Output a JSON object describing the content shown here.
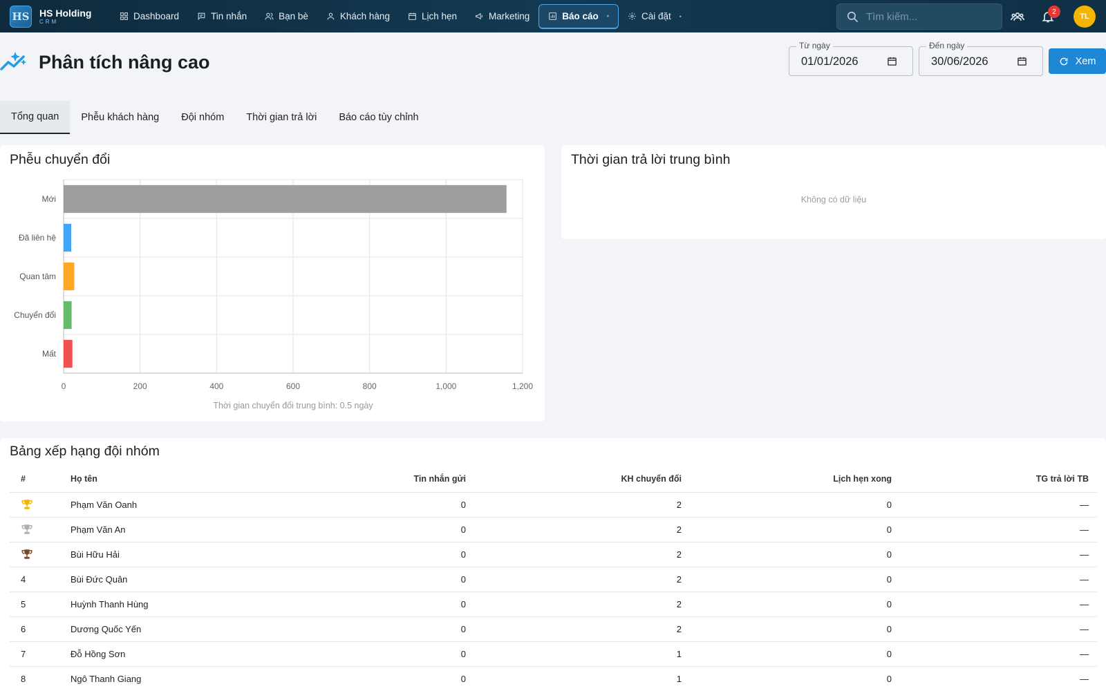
{
  "brand": {
    "name": "HS Holding",
    "sub": "CRM",
    "logo": "HS"
  },
  "nav": [
    {
      "label": "Dashboard",
      "icon": "dashboard-icon"
    },
    {
      "label": "Tin nhắn",
      "icon": "chat-icon"
    },
    {
      "label": "Bạn bè",
      "icon": "friends-icon"
    },
    {
      "label": "Khách hàng",
      "icon": "person-icon"
    },
    {
      "label": "Lịch hẹn",
      "icon": "calendar-icon"
    },
    {
      "label": "Marketing",
      "icon": "megaphone-icon"
    },
    {
      "label": "Báo cáo",
      "icon": "chart-icon",
      "active": true
    },
    {
      "label": "Cài đặt",
      "icon": "gear-icon"
    }
  ],
  "search": {
    "placeholder": "Tìm kiếm..."
  },
  "notifications": {
    "count": "2"
  },
  "user": {
    "initials": "TL"
  },
  "page": {
    "title": "Phân tích nâng cao"
  },
  "filters": {
    "from_label": "Từ ngày",
    "from_value": "01/01/2026",
    "to_label": "Đến ngày",
    "to_value": "30/06/2026",
    "view_label": "Xem"
  },
  "tabs": [
    "Tổng quan",
    "Phễu khách hàng",
    "Đội nhóm",
    "Thời gian trả lời",
    "Báo cáo tùy chỉnh"
  ],
  "funnel_card": {
    "title": "Phễu chuyển đổi",
    "note": "Thời gian chuyển đổi trung bình: 0.5 ngày"
  },
  "response_card": {
    "title": "Thời gian trả lời trung bình",
    "empty": "Không có dữ liệu"
  },
  "chart_data": {
    "type": "bar",
    "orientation": "horizontal",
    "categories": [
      "Mới",
      "Đã liên hệ",
      "Quan tâm",
      "Chuyển đổi",
      "Mất"
    ],
    "values": [
      1158,
      20,
      28,
      21,
      23
    ],
    "colors": [
      "#9e9e9e",
      "#42a5f5",
      "#ffa726",
      "#66bb6a",
      "#ef5350"
    ],
    "xlim": [
      0,
      1200
    ],
    "xticks": [
      0,
      200,
      400,
      600,
      800,
      1000,
      1200
    ],
    "xtick_labels": [
      "0",
      "200",
      "400",
      "600",
      "800",
      "1,000",
      "1,200"
    ],
    "grid": true
  },
  "leaderboard": {
    "title": "Bảng xếp hạng đội nhóm",
    "columns": [
      "#",
      "Họ tên",
      "Tin nhắn gửi",
      "KH chuyển đổi",
      "Lịch hẹn xong",
      "TG trả lời TB"
    ],
    "rows": [
      {
        "rank": "",
        "trophy": "gold",
        "name": "Phạm Văn Oanh",
        "sent": "0",
        "converted": "2",
        "done": "0",
        "resp": "—"
      },
      {
        "rank": "",
        "trophy": "silver",
        "name": "Phạm Văn An",
        "sent": "0",
        "converted": "2",
        "done": "0",
        "resp": "—"
      },
      {
        "rank": "",
        "trophy": "bronze",
        "name": "Bùi Hữu Hải",
        "sent": "0",
        "converted": "2",
        "done": "0",
        "resp": "—"
      },
      {
        "rank": "4",
        "name": "Bùi Đức Quân",
        "sent": "0",
        "converted": "2",
        "done": "0",
        "resp": "—"
      },
      {
        "rank": "5",
        "name": "Huỳnh Thanh Hùng",
        "sent": "0",
        "converted": "2",
        "done": "0",
        "resp": "—"
      },
      {
        "rank": "6",
        "name": "Dương Quốc Yến",
        "sent": "0",
        "converted": "2",
        "done": "0",
        "resp": "—"
      },
      {
        "rank": "7",
        "name": "Đỗ Hồng Sơn",
        "sent": "0",
        "converted": "1",
        "done": "0",
        "resp": "—"
      },
      {
        "rank": "8",
        "name": "Ngô Thanh Giang",
        "sent": "0",
        "converted": "1",
        "done": "0",
        "resp": "—"
      }
    ],
    "trophy_colors": {
      "gold": "#f5b400",
      "silver": "#b0b0b0",
      "bronze": "#7b4a2e"
    }
  }
}
